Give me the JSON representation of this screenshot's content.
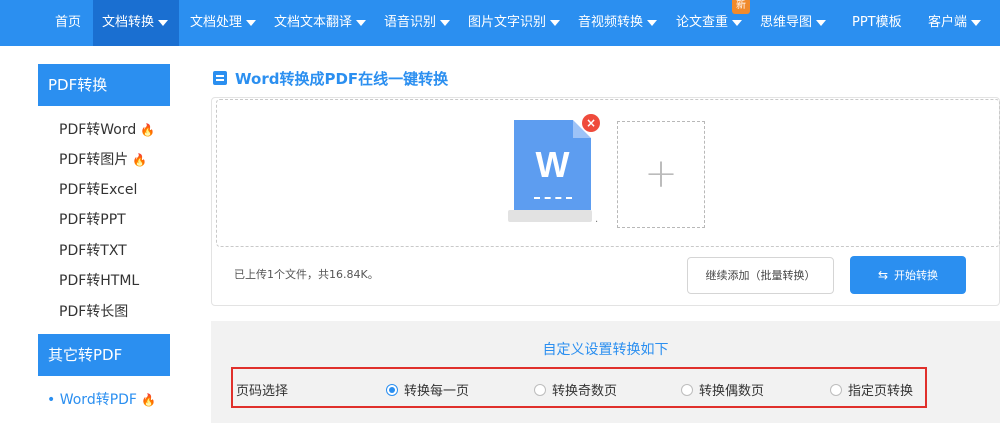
{
  "nav": {
    "items": [
      {
        "label": "首页",
        "dropdown": false
      },
      {
        "label": "文档转换",
        "dropdown": true,
        "active": true
      },
      {
        "label": "文档处理",
        "dropdown": true
      },
      {
        "label": "文档文本翻译",
        "dropdown": true
      },
      {
        "label": "语音识别",
        "dropdown": true
      },
      {
        "label": "图片文字识别",
        "dropdown": true
      },
      {
        "label": "音视频转换",
        "dropdown": true
      },
      {
        "label": "论文查重",
        "dropdown": true
      },
      {
        "label": "思维导图",
        "dropdown": true
      },
      {
        "label": "PPT模板",
        "dropdown": false
      },
      {
        "label": "客户端",
        "dropdown": true
      }
    ],
    "new_badge": "新"
  },
  "sidebar": {
    "sections": [
      {
        "title": "PDF转换",
        "items": [
          {
            "label": "PDF转Word",
            "hot": true
          },
          {
            "label": "PDF转图片",
            "hot": true
          },
          {
            "label": "PDF转Excel",
            "hot": false
          },
          {
            "label": "PDF转PPT",
            "hot": false
          },
          {
            "label": "PDF转TXT",
            "hot": false
          },
          {
            "label": "PDF转HTML",
            "hot": false
          },
          {
            "label": "PDF转长图",
            "hot": false
          }
        ]
      },
      {
        "title": "其它转PDF",
        "items": [
          {
            "label": "Word转PDF",
            "hot": true,
            "current": true
          }
        ]
      }
    ],
    "hot_icon": "flame-icon",
    "bullet": "•"
  },
  "main": {
    "title": "Word转换成PDF在线一键转换",
    "file": {
      "type_letter": "W",
      "remove_symbol": "×"
    },
    "add_symbol": "+",
    "upload_status": "已上传1个文件，共16.84K。",
    "continue_button": "继续添加（批量转换）",
    "start_button": "开始转换",
    "settings_title": "自定义设置转换如下",
    "page_select_label": "页码选择",
    "page_options": [
      {
        "label": "转换每一页",
        "selected": true
      },
      {
        "label": "转换奇数页",
        "selected": false
      },
      {
        "label": "转换偶数页",
        "selected": false
      },
      {
        "label": "指定页转换",
        "selected": false
      }
    ]
  },
  "colors": {
    "primary": "#2b8ff0",
    "active_nav": "#1a6fd1",
    "highlight": "#e0302b",
    "hot": "#f47a20",
    "badge": "#f08a2c"
  }
}
